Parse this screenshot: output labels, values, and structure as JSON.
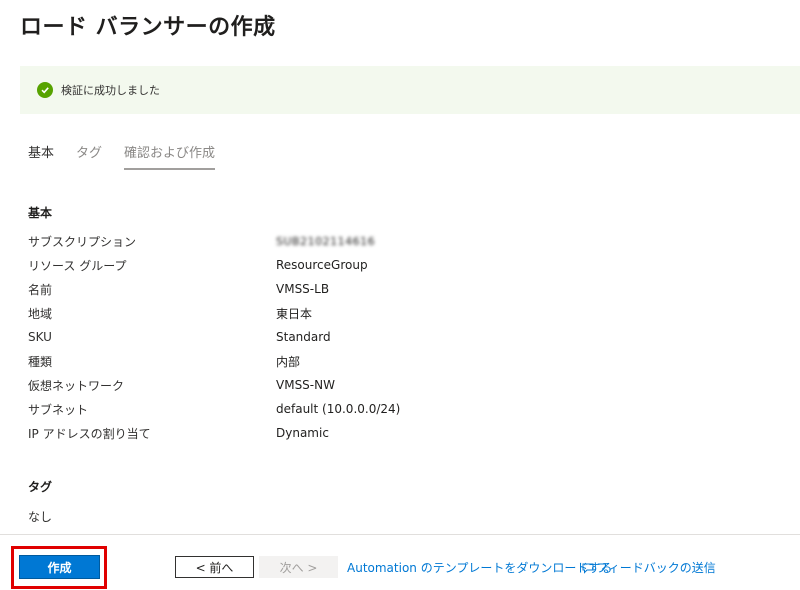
{
  "header": {
    "title": "ロード バランサーの作成",
    "more": "…"
  },
  "banner": {
    "text": "検証に成功しました"
  },
  "tabs": [
    {
      "label": "基本"
    },
    {
      "label": "タグ"
    },
    {
      "label": "確認および作成"
    }
  ],
  "basics": {
    "title": "基本",
    "rows": [
      {
        "label": "サブスクリプション",
        "value": "SUB2102114616"
      },
      {
        "label": "リソース グループ",
        "value": "ResourceGroup"
      },
      {
        "label": "名前",
        "value": "VMSS-LB"
      },
      {
        "label": "地域",
        "value": "東日本"
      },
      {
        "label": "SKU",
        "value": "Standard"
      },
      {
        "label": "種類",
        "value": "内部"
      },
      {
        "label": "仮想ネットワーク",
        "value": "VMSS-NW"
      },
      {
        "label": "サブネット",
        "value": "default (10.0.0.0/24)"
      },
      {
        "label": "IP アドレスの割り当て",
        "value": "Dynamic"
      }
    ]
  },
  "tags": {
    "title": "タグ",
    "value": "なし"
  },
  "footer": {
    "create": "作成",
    "prev": "< 前へ",
    "next": "次へ >",
    "automation": "Automation のテンプレートをダウンロードする",
    "feedback": "フィードバックの送信"
  }
}
